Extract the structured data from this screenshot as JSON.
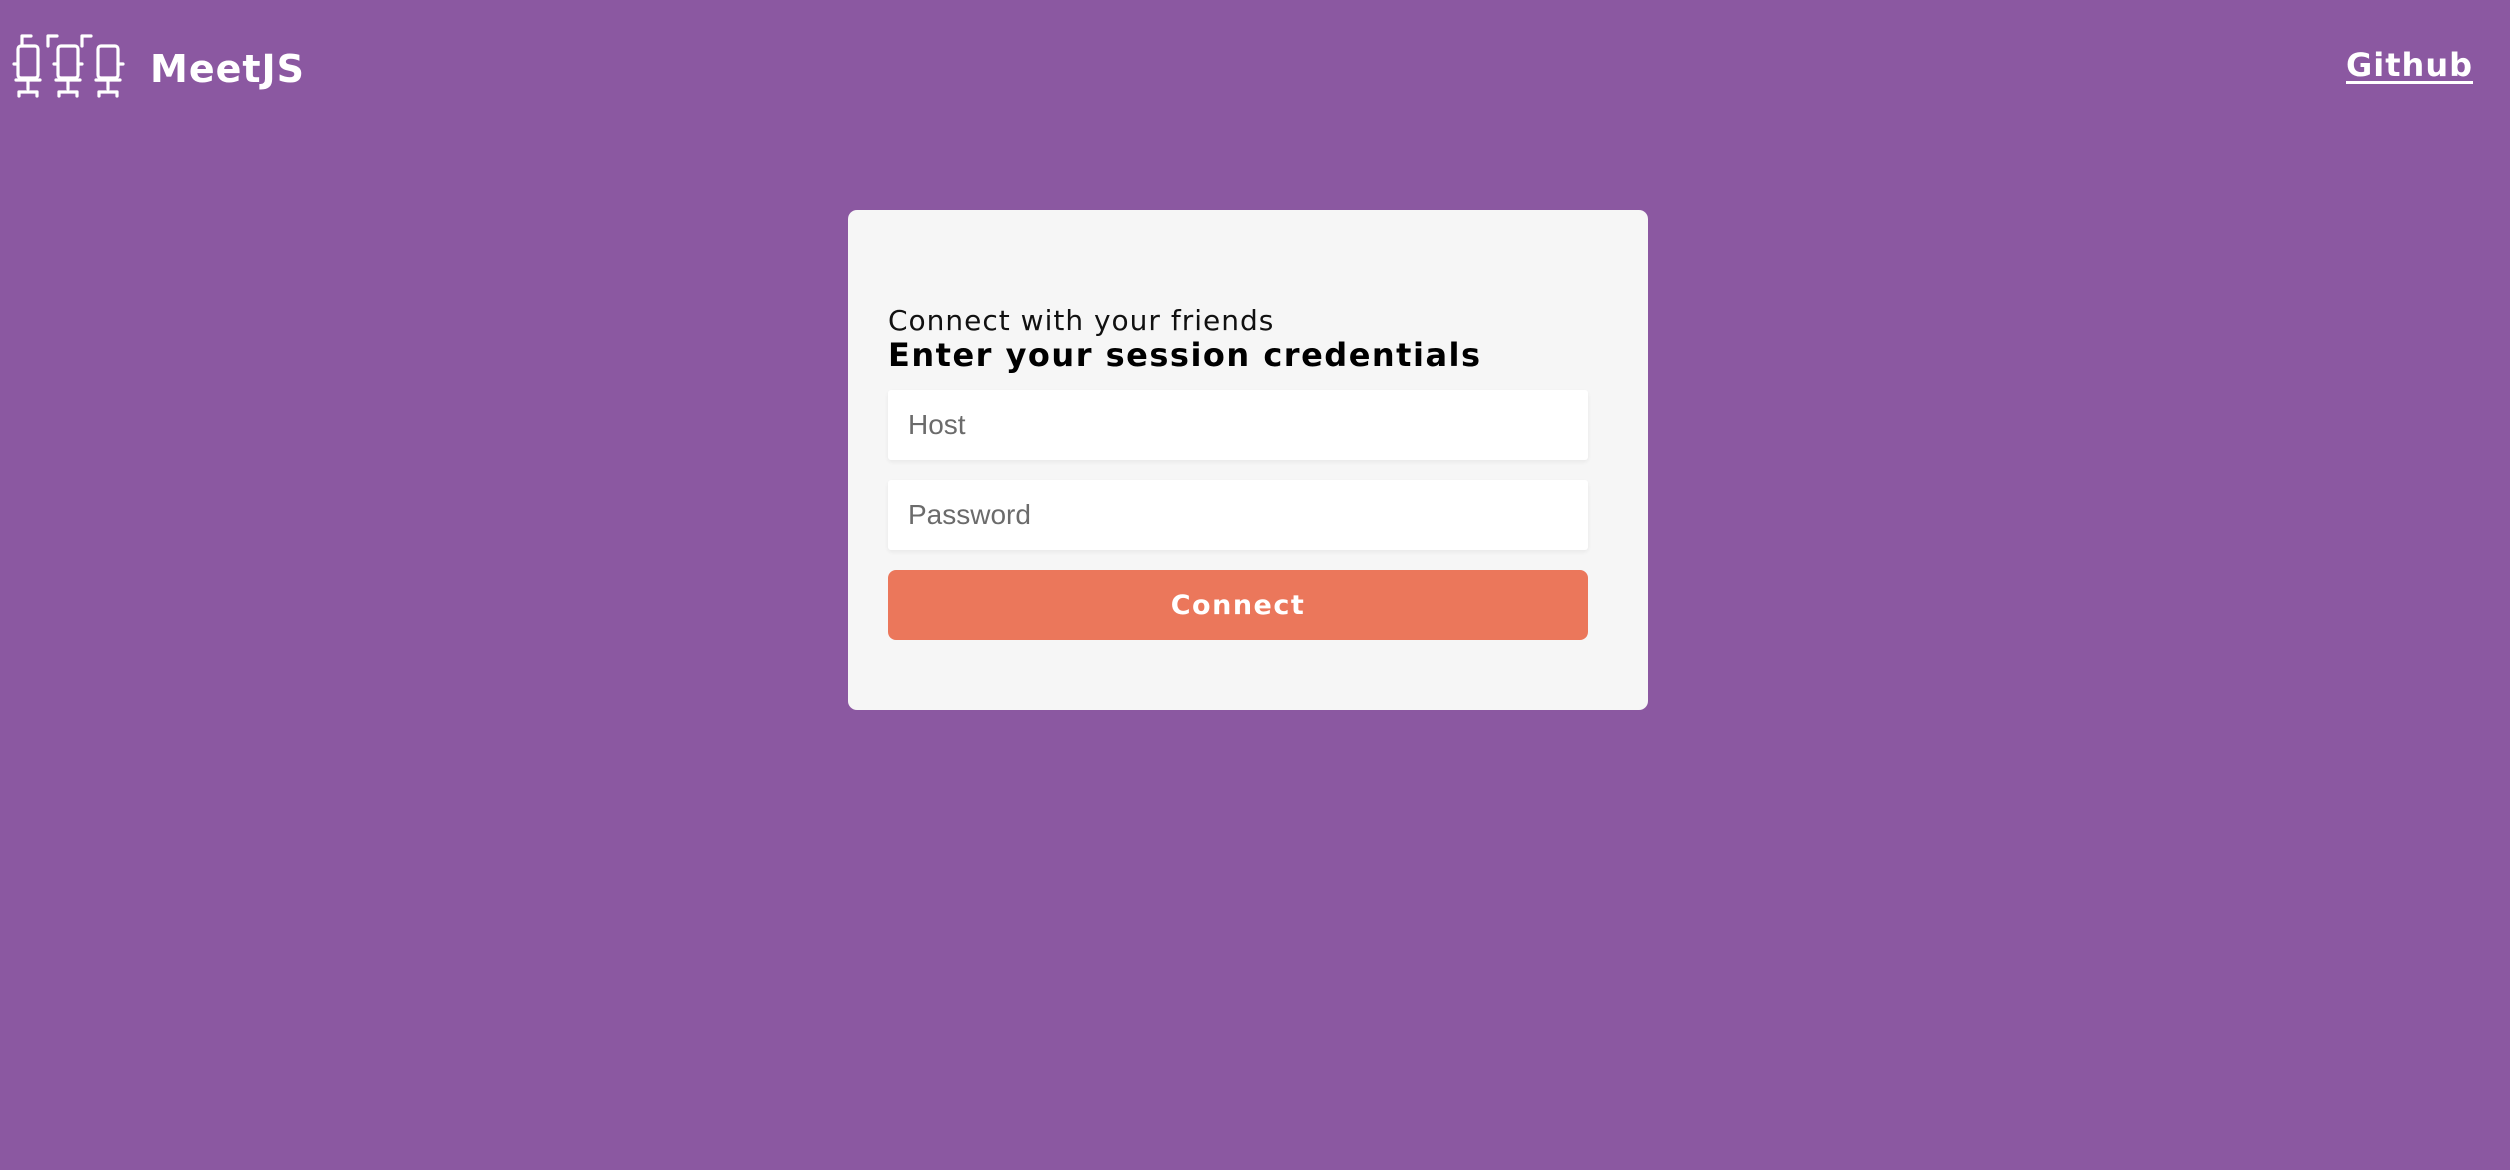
{
  "header": {
    "brand_name": "MeetJS",
    "logo_icon": "conference-chairs-icon",
    "github_link": "Github"
  },
  "card": {
    "subtitle": "Connect with your friends",
    "title": "Enter your session credentials",
    "host_input": {
      "placeholder": "Host",
      "value": ""
    },
    "password_input": {
      "placeholder": "Password",
      "value": ""
    },
    "connect_button": "Connect"
  },
  "colors": {
    "background": "#8b58a1",
    "card_background": "#f6f6f6",
    "accent": "#eb775b",
    "header_text": "#ffffff"
  }
}
